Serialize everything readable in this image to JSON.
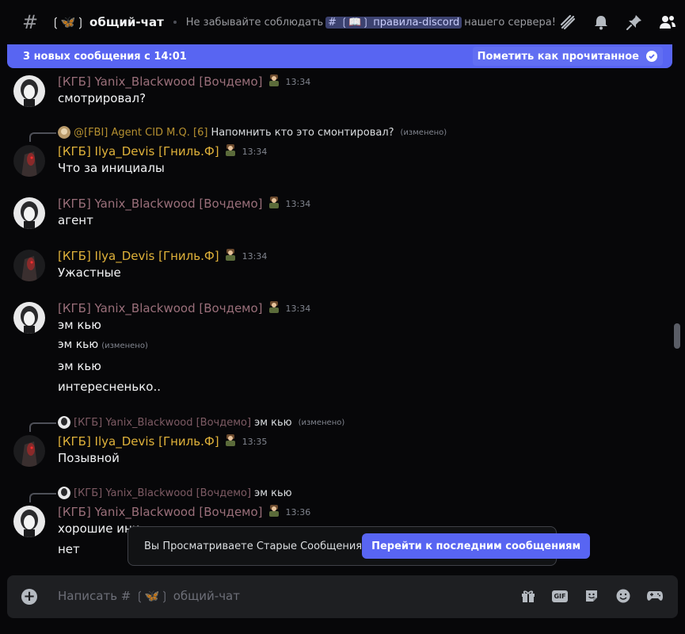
{
  "header": {
    "channel_name": "❲🦋❳ общий-чат",
    "topic_prefix": "Не забывайте соблюдать",
    "topic_mention": "# ❲📖❳ правила-discord",
    "topic_suffix": "нашего сервера!",
    "icons": [
      "threads-icon",
      "bell-icon",
      "pin-icon",
      "members-icon"
    ]
  },
  "banner": {
    "text": "3 новых сообщения с 14:01",
    "mark_read": "Пометить как прочитанное"
  },
  "messages": [
    {
      "author": "[КГБ] Yanix_Blackwood [Вочдемо]",
      "time": "13:34",
      "lines": [
        {
          "text": "смотрировал?",
          "edited": ""
        }
      ]
    },
    {
      "reply": {
        "author": "@[FBI] Agent CID M.Q. [6]",
        "text": "Напомнить кто это смонтировал?",
        "edited": "(изменено)"
      },
      "author": "[КГБ] Ilya_Devis [Гниль.Ф]",
      "time": "13:34",
      "lines": [
        {
          "text": "Что за инициалы",
          "edited": ""
        }
      ]
    },
    {
      "author": "[КГБ] Yanix_Blackwood [Вочдемо]",
      "time": "13:34",
      "lines": [
        {
          "text": "агент",
          "edited": ""
        }
      ]
    },
    {
      "author": "[КГБ] Ilya_Devis [Гниль.Ф]",
      "time": "13:34",
      "lines": [
        {
          "text": "Ужастные",
          "edited": ""
        }
      ]
    },
    {
      "author": "[КГБ] Yanix_Blackwood [Вочдемо]",
      "time": "13:34",
      "lines": [
        {
          "text": "эм кью",
          "edited": ""
        },
        {
          "text": "эм кью",
          "edited": "(изменено)"
        },
        {
          "text": "эм кью",
          "edited": ""
        },
        {
          "text": "интересненько..",
          "edited": ""
        }
      ]
    },
    {
      "reply": {
        "author": "[КГБ] Yanix_Blackwood [Вочдемо]",
        "text": "эм кью",
        "edited": "(изменено)"
      },
      "author": "[КГБ] Ilya_Devis [Гниль.Ф]",
      "time": "13:35",
      "lines": [
        {
          "text": "Позывной",
          "edited": ""
        }
      ]
    },
    {
      "reply": {
        "author": "[КГБ] Yanix_Blackwood [Вочдемо]",
        "text": "эм кью",
        "edited": ""
      },
      "author": "[КГБ] Yanix_Blackwood [Вочдемо]",
      "time": "13:36",
      "lines": [
        {
          "text": "хорошие ини",
          "edited": ""
        },
        {
          "text": "нет",
          "edited": ""
        }
      ]
    }
  ],
  "toast": {
    "text": "Вы Просматриваете Старые Сообщения",
    "jump": "Перейти к последним сообщениям"
  },
  "composer": {
    "placeholder": "Написать # ❲🦋❳ общий-чат",
    "icons": [
      "gift-icon",
      "gif-icon",
      "sticker-icon",
      "emoji-icon",
      "games-icon"
    ],
    "gif_label": "GIF"
  },
  "colors": {
    "accent": "#5865f2",
    "ilya_name": "#e0b23a",
    "yanix_name": "#9a6f7a"
  }
}
